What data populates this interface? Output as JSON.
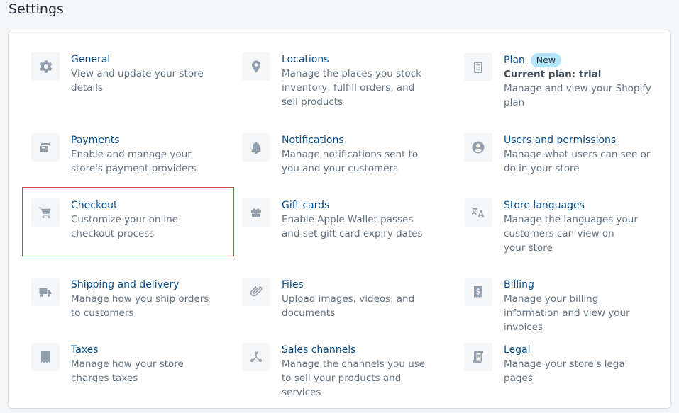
{
  "page": {
    "title": "Settings"
  },
  "items": {
    "general": {
      "title": "General",
      "desc": "View and update your store details",
      "icon": "gear-icon"
    },
    "locations": {
      "title": "Locations",
      "desc": "Manage the places you stock inventory, fulfill orders, and sell products",
      "icon": "location-pin-icon"
    },
    "plan": {
      "title": "Plan",
      "badge": "New",
      "subtitle": "Current plan: trial",
      "desc": "Manage and view your Shopify plan",
      "icon": "plan-document-icon"
    },
    "payments": {
      "title": "Payments",
      "desc": "Enable and manage your store's payment providers",
      "icon": "payments-icon"
    },
    "notifications": {
      "title": "Notifications",
      "desc": "Manage notifications sent to you and your customers",
      "icon": "bell-icon"
    },
    "users": {
      "title": "Users and permissions",
      "desc": "Manage what users can see or do in your store",
      "icon": "user-icon"
    },
    "checkout": {
      "title": "Checkout",
      "desc": "Customize your online checkout process",
      "icon": "cart-icon"
    },
    "giftcards": {
      "title": "Gift cards",
      "desc": "Enable Apple Wallet passes and set gift card expiry dates",
      "icon": "gift-icon"
    },
    "languages": {
      "title": "Store languages",
      "desc": "Manage the languages your customers can view on your store",
      "icon": "translate-icon"
    },
    "shipping": {
      "title": "Shipping and delivery",
      "desc": "Manage how you ship orders to customers",
      "icon": "truck-icon"
    },
    "files": {
      "title": "Files",
      "desc": "Upload images, videos, and documents",
      "icon": "paperclip-icon"
    },
    "billing": {
      "title": "Billing",
      "desc": "Manage your billing information and view your invoices",
      "icon": "billing-receipt-icon"
    },
    "taxes": {
      "title": "Taxes",
      "desc": "Manage how your store charges taxes",
      "icon": "tax-receipt-icon"
    },
    "channels": {
      "title": "Sales channels",
      "desc": "Manage the channels you use to sell your products and services",
      "icon": "channels-icon"
    },
    "legal": {
      "title": "Legal",
      "desc": "Manage your store's legal pages",
      "icon": "legal-document-icon"
    }
  },
  "colors": {
    "link": "#084e8a",
    "muted_text": "#637381",
    "icon": "#919eab",
    "icon_bg": "#f4f6f8",
    "badge_bg": "#b4e5fa",
    "highlight": "#c44a3a"
  }
}
